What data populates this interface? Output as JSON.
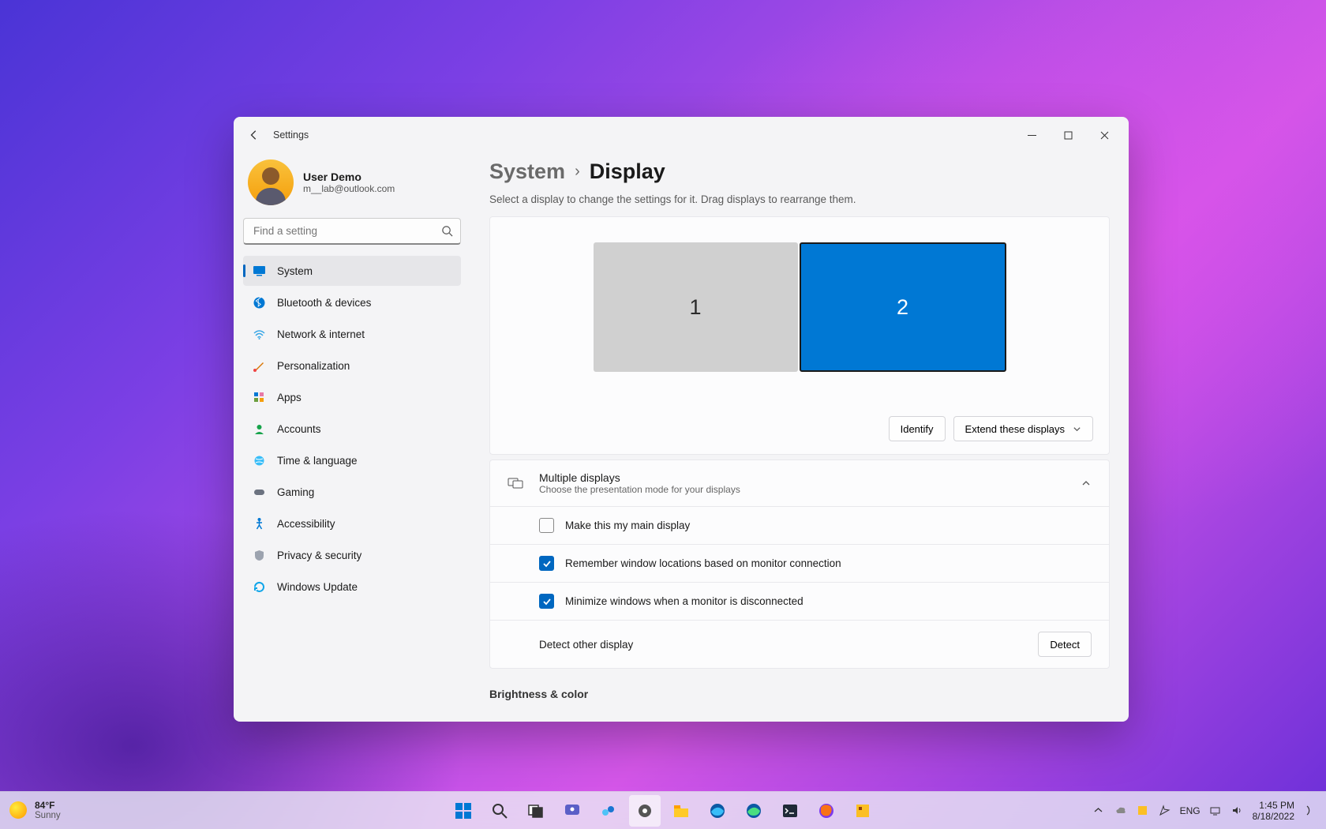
{
  "window": {
    "title": "Settings"
  },
  "profile": {
    "name": "User Demo",
    "email": "m__lab@outlook.com"
  },
  "search": {
    "placeholder": "Find a setting"
  },
  "nav": [
    {
      "label": "System"
    },
    {
      "label": "Bluetooth & devices"
    },
    {
      "label": "Network & internet"
    },
    {
      "label": "Personalization"
    },
    {
      "label": "Apps"
    },
    {
      "label": "Accounts"
    },
    {
      "label": "Time & language"
    },
    {
      "label": "Gaming"
    },
    {
      "label": "Accessibility"
    },
    {
      "label": "Privacy & security"
    },
    {
      "label": "Windows Update"
    }
  ],
  "breadcrumb": {
    "parent": "System",
    "current": "Display"
  },
  "subtitle": "Select a display to change the settings for it. Drag displays to rearrange them.",
  "displays": {
    "monitor1_label": "1",
    "monitor2_label": "2",
    "identify_btn": "Identify",
    "extend_dropdown": "Extend these displays"
  },
  "multiple_displays": {
    "title": "Multiple displays",
    "description": "Choose the presentation mode for your displays",
    "options": {
      "main_display": "Make this my main display",
      "remember_locations": "Remember window locations based on monitor connection",
      "minimize_disconnect": "Minimize windows when a monitor is disconnected"
    },
    "detect_label": "Detect other display",
    "detect_btn": "Detect"
  },
  "brightness_heading": "Brightness & color",
  "taskbar": {
    "weather": {
      "temp": "84°F",
      "condition": "Sunny"
    },
    "language": "ENG",
    "time": "1:45 PM",
    "date": "8/18/2022"
  }
}
